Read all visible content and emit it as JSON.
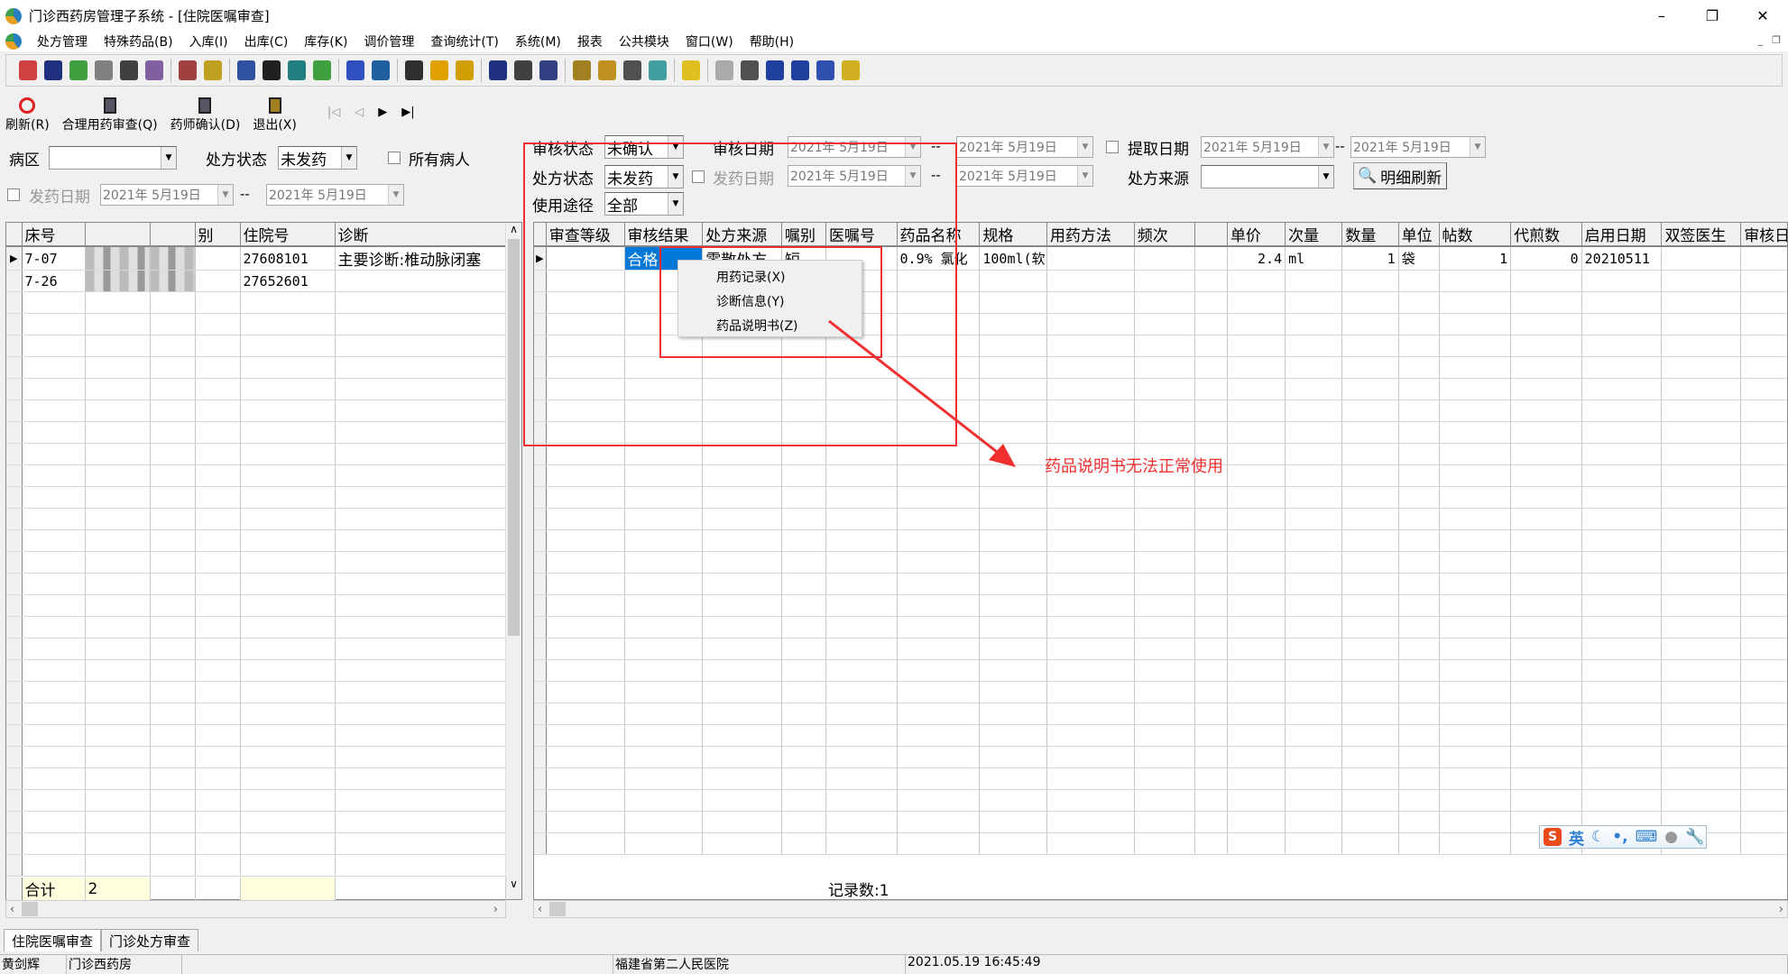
{
  "window": {
    "title": "门诊西药房管理子系统 - [住院医嘱审查]",
    "minimize": "–",
    "restore": "❐",
    "close": "✕"
  },
  "menu": [
    "处方管理",
    "特殊药品(B)",
    "入库(I)",
    "出库(C)",
    "库存(K)",
    "调价管理",
    "查询统计(T)",
    "系统(M)",
    "报表",
    "公共模块",
    "窗口(W)",
    "帮助(H)"
  ],
  "toolbar_icons": [
    {
      "name": "prescription-icon",
      "color": "#d04040"
    },
    {
      "name": "bottle-icon",
      "color": "#203080"
    },
    {
      "name": "check-icon",
      "color": "#40a040"
    },
    {
      "name": "document-pen-icon",
      "color": "#808080"
    },
    {
      "name": "binoculars-icon",
      "color": "#404040"
    },
    {
      "name": "pills-icon",
      "color": "#8060a0"
    },
    {
      "name": "medicine-box-icon",
      "color": "#a04040"
    },
    {
      "name": "sparkle-icon",
      "color": "#c0a020"
    },
    {
      "name": "clipboard-red-icon",
      "color": "#3050a0"
    },
    {
      "name": "checkbox-icon",
      "color": "#202020"
    },
    {
      "name": "clipboard-arrow-icon",
      "color": "#208080"
    },
    {
      "name": "doc-check-icon",
      "color": "#40a040"
    },
    {
      "name": "calendar-edit-icon",
      "color": "#3050c0"
    },
    {
      "name": "grid-edit-icon",
      "color": "#2060a0"
    },
    {
      "name": "abacus-icon",
      "color": "#303030"
    },
    {
      "name": "bell-icon",
      "color": "#e0a000"
    },
    {
      "name": "pin-icon",
      "color": "#d0a000"
    },
    {
      "name": "trash-icon",
      "color": "#203080"
    },
    {
      "name": "tools-icon",
      "color": "#404040"
    },
    {
      "name": "tools2-icon",
      "color": "#304080"
    },
    {
      "name": "folder-icon",
      "color": "#a08020"
    },
    {
      "name": "key-icon",
      "color": "#c09020"
    },
    {
      "name": "magnifier-icon",
      "color": "#505050"
    },
    {
      "name": "close-box-icon",
      "color": "#40a0a0"
    },
    {
      "name": "folder-arrow-icon",
      "color": "#e0c020"
    },
    {
      "name": "disk-icon",
      "color": "#aaaaaa"
    },
    {
      "name": "zoom-icon",
      "color": "#505050"
    },
    {
      "name": "list-icon",
      "color": "#2040a0"
    },
    {
      "name": "windows-icon",
      "color": "#2040a0"
    },
    {
      "name": "doc-tick-icon",
      "color": "#3050b0"
    },
    {
      "name": "clipboard-yellow-icon",
      "color": "#d0b020"
    }
  ],
  "buttons": {
    "refresh": "刷新(R)",
    "rational_check": "合理用药审查(Q)",
    "pharmacist_confirm": "药师确认(D)",
    "exit": "退出(X)"
  },
  "nav": {
    "first": "|◁",
    "prev": "◁",
    "next": "▶",
    "last": "▶|"
  },
  "left_filter": {
    "ward_label": "病区",
    "ward_value": "",
    "rx_status_label": "处方状态",
    "rx_status_value": "未发药",
    "all_patients_label": "所有病人",
    "dispense_date_label": "发药日期",
    "date_from": "2021年 5月19日",
    "sep": "--",
    "date_to": "2021年 5月19日"
  },
  "right_filter": {
    "review_status_label": "审核状态",
    "review_status_value": "未确认",
    "review_date_label": "审核日期",
    "review_date_from": "2021年 5月19日",
    "review_date_to": "2021年 5月19日",
    "sep": "--",
    "extract_date_label": "提取日期",
    "extract_date_from": "2021年 5月19日",
    "extract_date_to": "2021年 5月19日",
    "rx_status_label": "处方状态",
    "rx_status_value": "未发药",
    "dispense_date_label": "发药日期",
    "dispense_date_from": "2021年 5月19日",
    "dispense_date_to": "2021年 5月19日",
    "rx_source_label": "处方来源",
    "rx_source_value": "",
    "usage_label": "使用途径",
    "usage_value": "全部",
    "detail_refresh": "明细刷新"
  },
  "left_grid": {
    "columns": [
      "床号",
      "",
      "",
      "别",
      "住院号",
      "诊断"
    ],
    "rows": [
      [
        "7-07",
        "",
        "",
        "",
        "27608101",
        "主要诊断:椎动脉闭塞"
      ],
      [
        "7-26",
        "",
        "",
        "",
        "27652601",
        ""
      ]
    ],
    "total_label": "合计",
    "total_value": "2"
  },
  "right_grid": {
    "columns": [
      "审查等级",
      "审核结果",
      "处方来源",
      "嘱别",
      "医嘱号",
      "药品名称",
      "规格",
      "用药方法",
      "频次",
      "",
      "单价",
      "次量",
      "数量",
      "单位",
      "帖数",
      "代煎数",
      "启用日期",
      "双签医生",
      "审核日期"
    ],
    "rows": [
      [
        "",
        "合格",
        "零散处方",
        "短",
        "",
        "0.9% 氯化",
        "100ml(软",
        "",
        "",
        "",
        "2.4",
        "ml",
        "1",
        "袋",
        "1",
        "0",
        "20210511",
        "",
        ""
      ]
    ],
    "record_count": "记录数:1"
  },
  "context_menu": [
    "用药记录(X)",
    "诊断信息(Y)",
    "药品说明书(Z)"
  ],
  "annotation": {
    "text": "药品说明书无法正常使用",
    "color": "#f03030"
  },
  "ime": {
    "logo": "S",
    "lang": "英"
  },
  "tabs": [
    "住院医嘱审查",
    "门诊处方审查"
  ],
  "status": [
    "黄剑辉",
    "门诊西药房",
    "",
    "福建省第二人民医院",
    "2021.05.19 16:45:49"
  ]
}
